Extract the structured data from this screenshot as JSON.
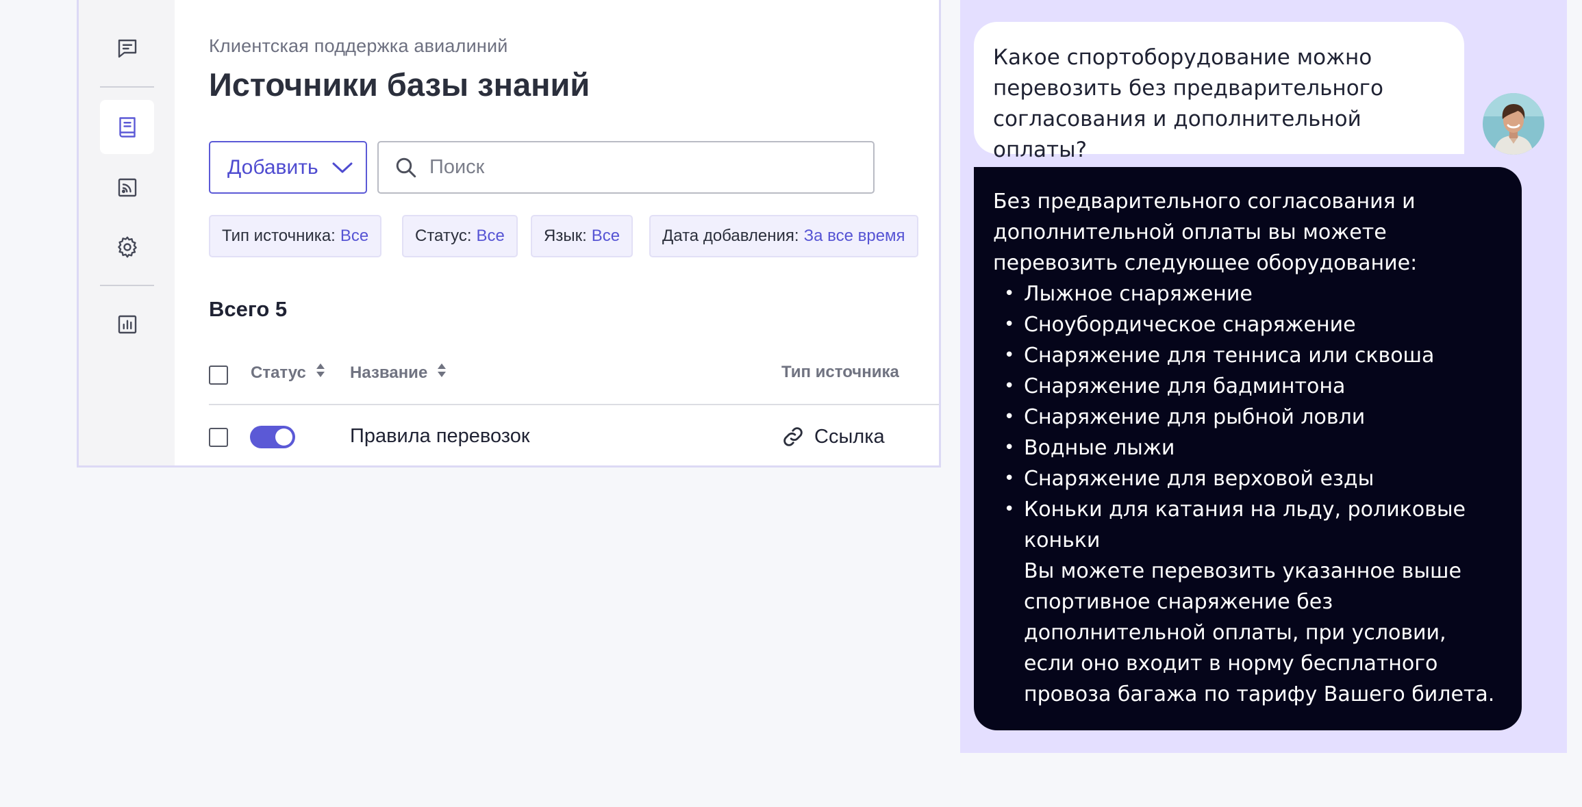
{
  "knowledge_base": {
    "breadcrumb": "Клиентская поддержка авиалиний",
    "title": "Источники базы знаний",
    "add_button": "Добавить",
    "search": {
      "placeholder": "Поиск",
      "value": ""
    },
    "filters": [
      {
        "label": "Тип источника:",
        "value": "Все"
      },
      {
        "label": "Статус:",
        "value": "Все"
      },
      {
        "label": "Язык:",
        "value": "Все"
      },
      {
        "label": "Дата добавления:",
        "value": "За все время"
      }
    ],
    "total": "Всего 5",
    "table": {
      "columns": {
        "status": "Статус",
        "name": "Название",
        "source_type": "Тип источника"
      },
      "rows": [
        {
          "enabled": true,
          "name": "Правила перевозок",
          "source_type": "Ссылка",
          "source_icon": "link-icon"
        }
      ]
    },
    "sidebar": {
      "items": [
        {
          "icon": "chat-icon",
          "active": false
        },
        {
          "icon": "book-icon",
          "active": true
        },
        {
          "icon": "rss-icon",
          "active": false
        },
        {
          "icon": "gear-icon",
          "active": false
        },
        {
          "icon": "bar-chart-icon",
          "active": false
        }
      ]
    }
  },
  "chat": {
    "user_message": "Какое спортоборудование можно перевозить без предварительного согласования и дополнительной оплаты?",
    "bot_reply": {
      "intro": "Без предварительного согласования и дополнительной оплаты вы можете перевозить следующее оборудование:",
      "items": [
        "Лыжное снаряжение",
        "Сноубордическое снаряжение",
        "Снаряжение для тенниса или сквоша",
        "Снаряжение для бадминтона",
        "Снаряжение для рыбной ловли",
        "Водные лыжи",
        "Снаряжение для верховой езды",
        "Коньки для катания на льду, роликовые коньки"
      ],
      "closing": "Вы можете перевозить указанное выше спортивное снаряжение без дополнительной оплаты, при условии, если оно входит в норму бесплатного провоза багажа по тарифу Вашего билета."
    }
  },
  "colors": {
    "accent": "#5b59d6",
    "chip_bg": "#f1f0fd",
    "chat_bg": "#e4dfff",
    "bot_bubble": "#05051a"
  }
}
